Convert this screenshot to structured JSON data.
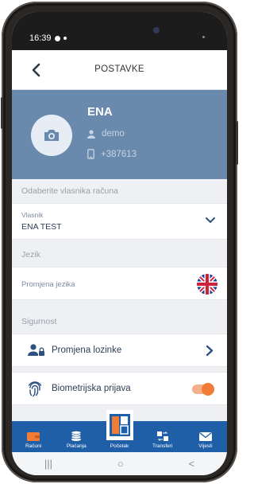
{
  "status_bar": {
    "time": "16:39"
  },
  "header": {
    "title": "POSTAVKE"
  },
  "profile": {
    "name": "ENA",
    "username": "demo",
    "phone": "+387613"
  },
  "owner_section": {
    "heading": "Odaberite vlasnika računa",
    "field_label": "Vlasnik",
    "field_value": "ENA TEST"
  },
  "language_section": {
    "heading": "Jezik",
    "row_label": "Promjena jezika"
  },
  "security_section": {
    "heading": "Sigurnost",
    "password_label": "Promjena lozinke",
    "biometric_label": "Biometrijska prijava",
    "biometric_enabled": true
  },
  "tabs": [
    {
      "label": "Računi",
      "icon": "wallet-icon"
    },
    {
      "label": "Plaćanja",
      "icon": "coins-icon"
    },
    {
      "label": "Početak",
      "icon": "home-grid-icon"
    },
    {
      "label": "Transferi",
      "icon": "transfer-icon"
    },
    {
      "label": "Vijesti",
      "icon": "mail-icon"
    }
  ],
  "android_nav": {
    "recents": "|||",
    "home": "○",
    "back": "<"
  },
  "colors": {
    "primary": "#1f5fa8",
    "profile_bg": "#6a8aad",
    "accent": "#f07c35"
  }
}
